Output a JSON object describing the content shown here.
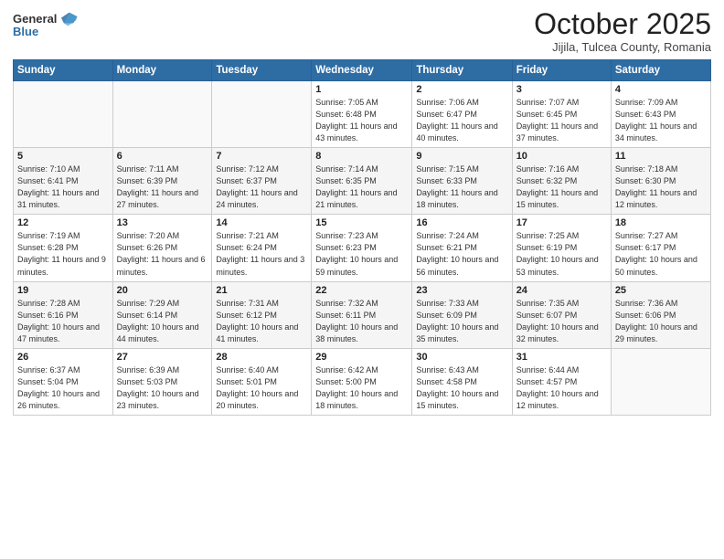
{
  "header": {
    "logo_general": "General",
    "logo_blue": "Blue",
    "month": "October 2025",
    "location": "Jijila, Tulcea County, Romania"
  },
  "weekdays": [
    "Sunday",
    "Monday",
    "Tuesday",
    "Wednesday",
    "Thursday",
    "Friday",
    "Saturday"
  ],
  "weeks": [
    [
      {
        "day": "",
        "info": ""
      },
      {
        "day": "",
        "info": ""
      },
      {
        "day": "",
        "info": ""
      },
      {
        "day": "1",
        "info": "Sunrise: 7:05 AM\nSunset: 6:48 PM\nDaylight: 11 hours and 43 minutes."
      },
      {
        "day": "2",
        "info": "Sunrise: 7:06 AM\nSunset: 6:47 PM\nDaylight: 11 hours and 40 minutes."
      },
      {
        "day": "3",
        "info": "Sunrise: 7:07 AM\nSunset: 6:45 PM\nDaylight: 11 hours and 37 minutes."
      },
      {
        "day": "4",
        "info": "Sunrise: 7:09 AM\nSunset: 6:43 PM\nDaylight: 11 hours and 34 minutes."
      }
    ],
    [
      {
        "day": "5",
        "info": "Sunrise: 7:10 AM\nSunset: 6:41 PM\nDaylight: 11 hours and 31 minutes."
      },
      {
        "day": "6",
        "info": "Sunrise: 7:11 AM\nSunset: 6:39 PM\nDaylight: 11 hours and 27 minutes."
      },
      {
        "day": "7",
        "info": "Sunrise: 7:12 AM\nSunset: 6:37 PM\nDaylight: 11 hours and 24 minutes."
      },
      {
        "day": "8",
        "info": "Sunrise: 7:14 AM\nSunset: 6:35 PM\nDaylight: 11 hours and 21 minutes."
      },
      {
        "day": "9",
        "info": "Sunrise: 7:15 AM\nSunset: 6:33 PM\nDaylight: 11 hours and 18 minutes."
      },
      {
        "day": "10",
        "info": "Sunrise: 7:16 AM\nSunset: 6:32 PM\nDaylight: 11 hours and 15 minutes."
      },
      {
        "day": "11",
        "info": "Sunrise: 7:18 AM\nSunset: 6:30 PM\nDaylight: 11 hours and 12 minutes."
      }
    ],
    [
      {
        "day": "12",
        "info": "Sunrise: 7:19 AM\nSunset: 6:28 PM\nDaylight: 11 hours and 9 minutes."
      },
      {
        "day": "13",
        "info": "Sunrise: 7:20 AM\nSunset: 6:26 PM\nDaylight: 11 hours and 6 minutes."
      },
      {
        "day": "14",
        "info": "Sunrise: 7:21 AM\nSunset: 6:24 PM\nDaylight: 11 hours and 3 minutes."
      },
      {
        "day": "15",
        "info": "Sunrise: 7:23 AM\nSunset: 6:23 PM\nDaylight: 10 hours and 59 minutes."
      },
      {
        "day": "16",
        "info": "Sunrise: 7:24 AM\nSunset: 6:21 PM\nDaylight: 10 hours and 56 minutes."
      },
      {
        "day": "17",
        "info": "Sunrise: 7:25 AM\nSunset: 6:19 PM\nDaylight: 10 hours and 53 minutes."
      },
      {
        "day": "18",
        "info": "Sunrise: 7:27 AM\nSunset: 6:17 PM\nDaylight: 10 hours and 50 minutes."
      }
    ],
    [
      {
        "day": "19",
        "info": "Sunrise: 7:28 AM\nSunset: 6:16 PM\nDaylight: 10 hours and 47 minutes."
      },
      {
        "day": "20",
        "info": "Sunrise: 7:29 AM\nSunset: 6:14 PM\nDaylight: 10 hours and 44 minutes."
      },
      {
        "day": "21",
        "info": "Sunrise: 7:31 AM\nSunset: 6:12 PM\nDaylight: 10 hours and 41 minutes."
      },
      {
        "day": "22",
        "info": "Sunrise: 7:32 AM\nSunset: 6:11 PM\nDaylight: 10 hours and 38 minutes."
      },
      {
        "day": "23",
        "info": "Sunrise: 7:33 AM\nSunset: 6:09 PM\nDaylight: 10 hours and 35 minutes."
      },
      {
        "day": "24",
        "info": "Sunrise: 7:35 AM\nSunset: 6:07 PM\nDaylight: 10 hours and 32 minutes."
      },
      {
        "day": "25",
        "info": "Sunrise: 7:36 AM\nSunset: 6:06 PM\nDaylight: 10 hours and 29 minutes."
      }
    ],
    [
      {
        "day": "26",
        "info": "Sunrise: 6:37 AM\nSunset: 5:04 PM\nDaylight: 10 hours and 26 minutes."
      },
      {
        "day": "27",
        "info": "Sunrise: 6:39 AM\nSunset: 5:03 PM\nDaylight: 10 hours and 23 minutes."
      },
      {
        "day": "28",
        "info": "Sunrise: 6:40 AM\nSunset: 5:01 PM\nDaylight: 10 hours and 20 minutes."
      },
      {
        "day": "29",
        "info": "Sunrise: 6:42 AM\nSunset: 5:00 PM\nDaylight: 10 hours and 18 minutes."
      },
      {
        "day": "30",
        "info": "Sunrise: 6:43 AM\nSunset: 4:58 PM\nDaylight: 10 hours and 15 minutes."
      },
      {
        "day": "31",
        "info": "Sunrise: 6:44 AM\nSunset: 4:57 PM\nDaylight: 10 hours and 12 minutes."
      },
      {
        "day": "",
        "info": ""
      }
    ]
  ]
}
